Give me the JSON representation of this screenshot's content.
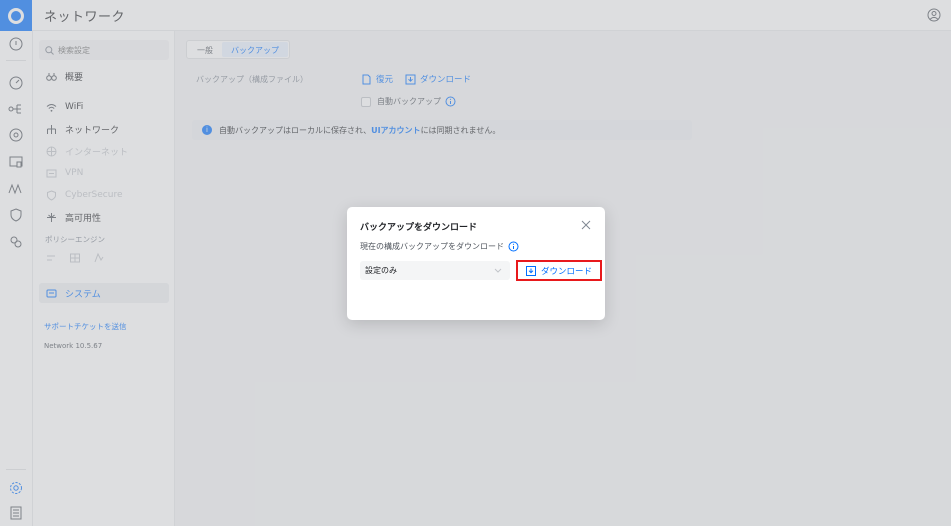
{
  "app": {
    "title": "ネットワーク"
  },
  "search": {
    "placeholder": "検索設定"
  },
  "sidebar": {
    "items": [
      {
        "label": "概要"
      },
      {
        "label": "WiFi"
      },
      {
        "label": "ネットワーク"
      },
      {
        "label": "インターネット"
      },
      {
        "label": "VPN"
      },
      {
        "label": "CyberSecure"
      },
      {
        "label": "高可用性"
      }
    ],
    "policy_label": "ポリシーエンジン",
    "system_label": "システム",
    "support_link": "サポートチケットを送信",
    "version": "Network 10.5.67"
  },
  "tabs": [
    {
      "label": "一般"
    },
    {
      "label": "バックアップ"
    }
  ],
  "backup": {
    "label": "バックアップ（構成ファイル）",
    "restore": "復元",
    "download": "ダウンロード",
    "auto_backup": "自動バックアップ"
  },
  "banner": {
    "text_before": "自動バックアップはローカルに保存され、",
    "link": "UIアカウント",
    "text_after": "には同期されません。"
  },
  "modal": {
    "title": "バックアップをダウンロード",
    "subtitle": "現在の構成バックアップをダウンロード",
    "select_value": "設定のみ",
    "download_button": "ダウンロード"
  },
  "colors": {
    "accent": "#006fff",
    "highlight": "#e8191c"
  }
}
